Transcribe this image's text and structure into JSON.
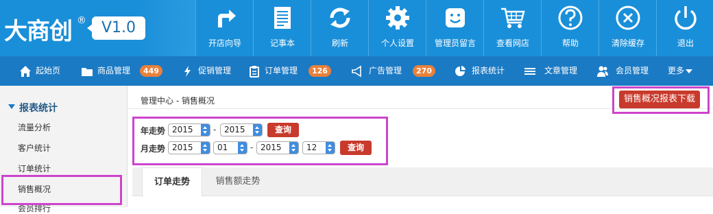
{
  "brand": {
    "name": "大商创",
    "reg": "®",
    "version": "V1.0"
  },
  "toolbar": [
    {
      "label": "开店向导",
      "icon": "share-arrow-icon"
    },
    {
      "label": "记事本",
      "icon": "notepad-icon"
    },
    {
      "label": "刷新",
      "icon": "refresh-icon"
    },
    {
      "label": "个人设置",
      "icon": "gear-icon"
    },
    {
      "label": "管理员留言",
      "icon": "smiley-message-icon"
    },
    {
      "label": "查看网店",
      "icon": "shopping-cart-icon"
    },
    {
      "label": "帮助",
      "icon": "help-icon"
    },
    {
      "label": "清除缓存",
      "icon": "clear-cache-icon"
    },
    {
      "label": "退出",
      "icon": "power-icon"
    }
  ],
  "nav": [
    {
      "label": "起始页",
      "icon": "home-icon"
    },
    {
      "label": "商品管理",
      "icon": "folder-icon",
      "badge": "449"
    },
    {
      "label": "促销管理",
      "icon": "lightning-icon"
    },
    {
      "label": "订单管理",
      "icon": "clipboard-icon",
      "badge": "126"
    },
    {
      "label": "广告管理",
      "icon": "megaphone-icon",
      "badge": "270"
    },
    {
      "label": "报表统计",
      "icon": "pie-chart-icon"
    },
    {
      "label": "文章管理",
      "icon": "list-icon"
    },
    {
      "label": "会员管理",
      "icon": "users-icon"
    },
    {
      "label": "更多",
      "icon": "caret-down-icon"
    }
  ],
  "sidebar": {
    "title": "报表统计",
    "items": [
      "流量分析",
      "客户统计",
      "订单统计",
      "销售概况",
      "会员排行"
    ]
  },
  "breadcrumb": {
    "root": "管理中心",
    "sep": " - ",
    "current": "销售概况"
  },
  "download_button": "销售概况报表下载",
  "year_trend": {
    "label": "年走势",
    "from": "2015",
    "sep": "-",
    "to": "2015",
    "query": "查询"
  },
  "month_trend": {
    "label": "月走势",
    "from_year": "2015",
    "from_month": "01",
    "sep": "-",
    "to_year": "2015",
    "to_month": "12",
    "query": "查询"
  },
  "tabs": [
    "订单走势",
    "销售额走势"
  ],
  "colors": {
    "header": "#1a8fd9",
    "nav": "#1b7ac4",
    "badge": "#e9813b",
    "button": "#c83a2c",
    "highlight": "#cc44cc"
  }
}
